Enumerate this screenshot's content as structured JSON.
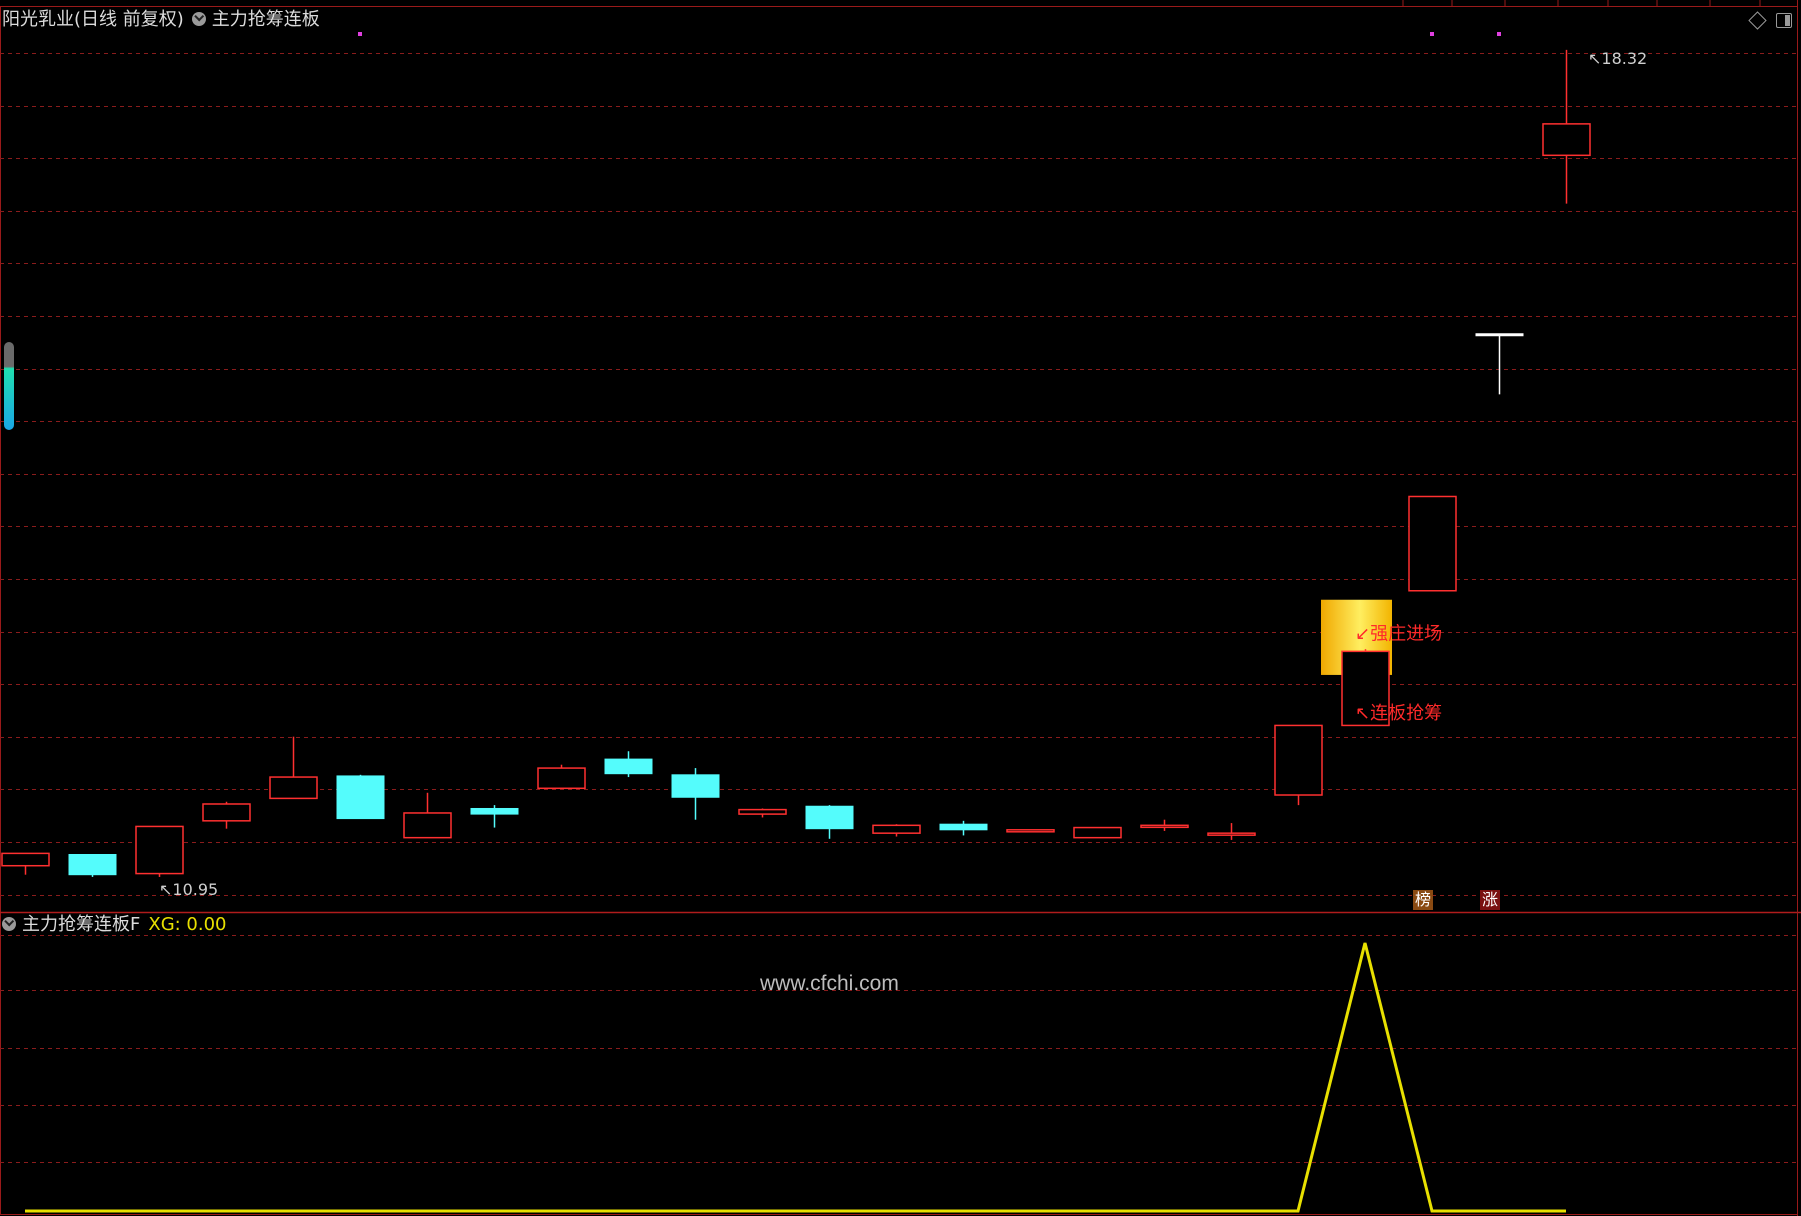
{
  "header": {
    "stock_title": "阳光乳业(日线 前复权)",
    "indicator_name": "主力抢筹连板"
  },
  "indicator": {
    "name": "主力抢筹连板F",
    "xg_text": "XG: 0.00"
  },
  "watermark": "www.cfchi.com",
  "badges": {
    "bang": "榜",
    "zhang": "涨"
  },
  "colors": {
    "up": "#ff3030",
    "down": "#54fcfc",
    "doji": "#ffffff",
    "grid": "#8a1c1c",
    "indicator_line": "#e8e000",
    "signal_text": "#ff2a2a",
    "signal_box": "#f2c200"
  },
  "icons": [
    "diamond-icon",
    "panel-toggle-icon",
    "dropdown-icon",
    "scroll-handle"
  ],
  "chart_data": [
    {
      "type": "candlestick",
      "title": "阳光乳业(日线 前复权)",
      "price_range": [
        10.7,
        18.55
      ],
      "candles": [
        {
          "open": 11.05,
          "high": 11.15,
          "low": 10.97,
          "close": 11.16
        },
        {
          "open": 11.15,
          "high": 11.15,
          "low": 10.95,
          "close": 10.97
        },
        {
          "open": 10.98,
          "high": 11.4,
          "low": 10.95,
          "close": 11.4
        },
        {
          "open": 11.45,
          "high": 11.62,
          "low": 11.38,
          "close": 11.6
        },
        {
          "open": 11.65,
          "high": 12.2,
          "low": 11.65,
          "close": 11.84
        },
        {
          "open": 11.85,
          "high": 11.86,
          "low": 11.47,
          "close": 11.47
        },
        {
          "open": 11.3,
          "high": 11.7,
          "low": 11.3,
          "close": 11.52
        },
        {
          "open": 11.56,
          "high": 11.59,
          "low": 11.39,
          "close": 11.51
        },
        {
          "open": 11.74,
          "high": 11.95,
          "low": 11.74,
          "close": 11.92
        },
        {
          "open": 12.0,
          "high": 12.07,
          "low": 11.84,
          "close": 11.87
        },
        {
          "open": 11.86,
          "high": 11.92,
          "low": 11.46,
          "close": 11.66
        },
        {
          "open": 11.51,
          "high": 11.56,
          "low": 11.48,
          "close": 11.55
        },
        {
          "open": 11.58,
          "high": 11.59,
          "low": 11.29,
          "close": 11.38
        },
        {
          "open": 11.34,
          "high": 11.42,
          "low": 11.31,
          "close": 11.41
        },
        {
          "open": 11.42,
          "high": 11.45,
          "low": 11.32,
          "close": 11.37
        },
        {
          "open": 11.36,
          "high": 11.37,
          "low": 11.35,
          "close": 11.37
        },
        {
          "open": 11.3,
          "high": 11.39,
          "low": 11.32,
          "close": 11.39
        },
        {
          "open": 11.41,
          "high": 11.46,
          "low": 11.36,
          "close": 11.41
        },
        {
          "open": 11.34,
          "high": 11.43,
          "low": 11.28,
          "close": 11.34
        },
        {
          "open": 11.68,
          "high": 12.3,
          "low": 11.59,
          "close": 12.3
        },
        {
          "open": 12.3,
          "high": 12.98,
          "low": 12.3,
          "close": 12.96
        },
        {
          "open": 13.5,
          "high": 14.34,
          "low": 13.5,
          "close": 14.34
        },
        {
          "open": 15.79,
          "high": 15.79,
          "low": 15.25,
          "close": 15.79
        },
        {
          "open": 17.38,
          "high": 18.32,
          "low": 16.95,
          "close": 17.66
        }
      ],
      "annotations": [
        {
          "text": "18.32",
          "kind": "high-marker",
          "candle": 23,
          "price": 18.32
        },
        {
          "text": "10.95",
          "kind": "low-marker",
          "candle": 1,
          "price": 10.95
        },
        {
          "text": "强庄进场",
          "kind": "signal",
          "candle": 20,
          "price": 13.12
        },
        {
          "text": "连板抢筹",
          "kind": "signal",
          "candle": 20,
          "price": 12.41
        }
      ],
      "signal_box": {
        "candle": 20,
        "top_price": 13.42,
        "bottom_price": 12.75
      },
      "dots": [
        {
          "candle": 5,
          "pos": "top"
        },
        {
          "candle": 21,
          "pos": "top"
        },
        {
          "candle": 22,
          "pos": "top"
        }
      ]
    },
    {
      "type": "line",
      "title": "主力抢筹连板F",
      "ylim": [
        0,
        1
      ],
      "series": [
        {
          "values": [
            0,
            0,
            0,
            0,
            0,
            0,
            0,
            0,
            0,
            0,
            0,
            0,
            0,
            0,
            0,
            0,
            0,
            0,
            0,
            0,
            1,
            0,
            0,
            0
          ]
        }
      ]
    }
  ]
}
